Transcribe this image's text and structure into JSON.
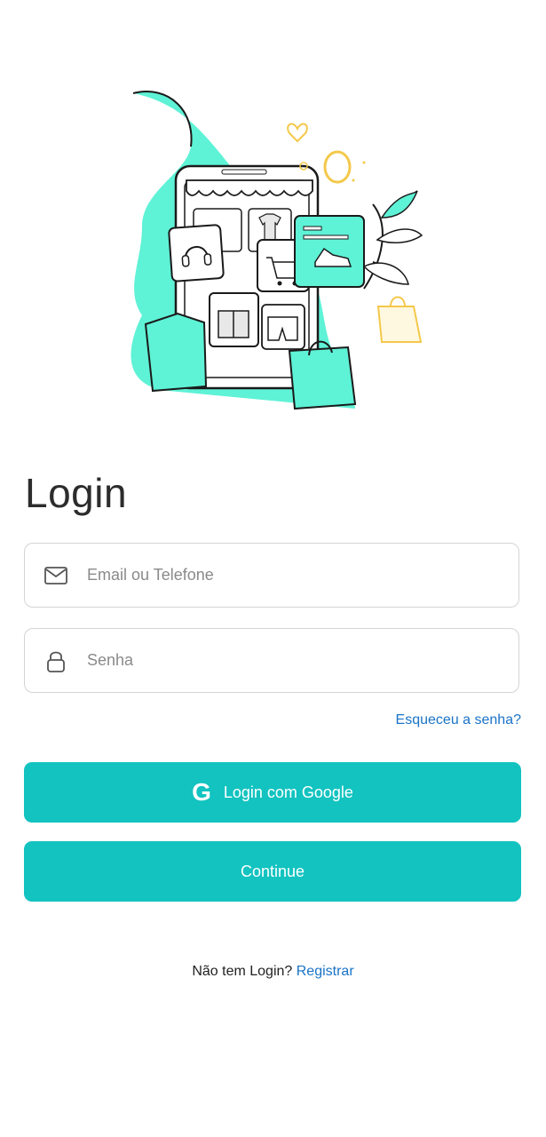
{
  "title": "Login",
  "email_field": {
    "placeholder": "Email ou Telefone",
    "value": "",
    "icon": "mail-icon"
  },
  "password_field": {
    "placeholder": "Senha",
    "value": "",
    "icon": "lock-icon"
  },
  "forgot_link": "Esqueceu a senha?",
  "google_button": {
    "label": "Login com Google",
    "icon": "google-icon"
  },
  "continue_button": {
    "label": "Continue"
  },
  "register": {
    "prompt": "Não tem Login?",
    "link": "Registrar"
  },
  "colors": {
    "accent": "#12c3c0",
    "link": "#1a73c7",
    "illustration_teal": "#5ef2d6",
    "illustration_gold": "#f4c84a"
  }
}
